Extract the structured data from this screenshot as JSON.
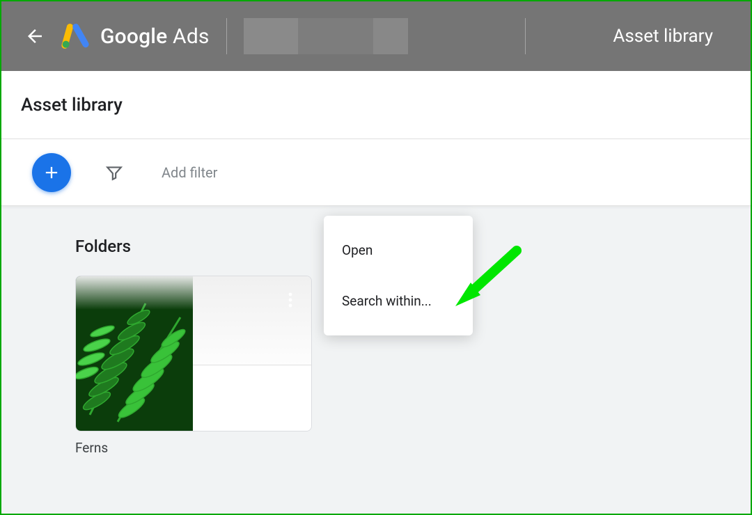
{
  "header": {
    "product_name_bold": "Google",
    "product_name_light": " Ads",
    "tool_title": "Asset library"
  },
  "subheader": {
    "title": "Asset library"
  },
  "toolbar": {
    "filter_placeholder": "Add filter"
  },
  "content": {
    "section_title": "Folders",
    "folder": {
      "name": "Ferns"
    }
  },
  "context_menu": {
    "items": [
      {
        "label": "Open"
      },
      {
        "label": "Search within..."
      }
    ]
  },
  "colors": {
    "primary": "#1a73e8",
    "annotation": "#00e600"
  }
}
